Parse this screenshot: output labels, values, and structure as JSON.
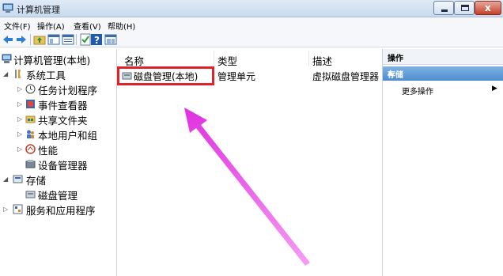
{
  "window": {
    "title": "计算机管理"
  },
  "menu": [
    "文件(F)",
    "操作(A)",
    "查看(V)",
    "帮助(H)"
  ],
  "toolbar": [
    "back-icon",
    "forward-icon",
    "up-folder-icon",
    "show-hide-tree-icon",
    "export-icon",
    "help-icon",
    "properties-icon"
  ],
  "tree": [
    {
      "label": "计算机管理(本地)",
      "icon": "computer-management-icon"
    },
    {
      "label": "系统工具",
      "icon": "system-tools-icon"
    },
    {
      "label": "任务计划程序",
      "icon": "clock-icon"
    },
    {
      "label": "事件查看器",
      "icon": "event-viewer-icon"
    },
    {
      "label": "共享文件夹",
      "icon": "shared-folder-icon"
    },
    {
      "label": "本地用户和组",
      "icon": "users-icon"
    },
    {
      "label": "性能",
      "icon": "performance-icon"
    },
    {
      "label": "设备管理器",
      "icon": "device-manager-icon"
    },
    {
      "label": "存储",
      "icon": "storage-icon"
    },
    {
      "label": "磁盘管理",
      "icon": "disk-icon"
    },
    {
      "label": "服务和应用程序",
      "icon": "services-icon"
    }
  ],
  "list": {
    "columns": [
      "名称",
      "类型",
      "描述"
    ],
    "rows": [
      {
        "name": "磁盘管理(本地)",
        "type": "管理单元",
        "desc": "虚拟磁盘管理器"
      }
    ]
  },
  "actions": {
    "header": "操作",
    "section": "存储",
    "items": [
      "更多操作"
    ]
  },
  "colors": {
    "highlight": "#e0222a",
    "arrow": "#e83ee8",
    "section_bg": "#5a97d2"
  }
}
